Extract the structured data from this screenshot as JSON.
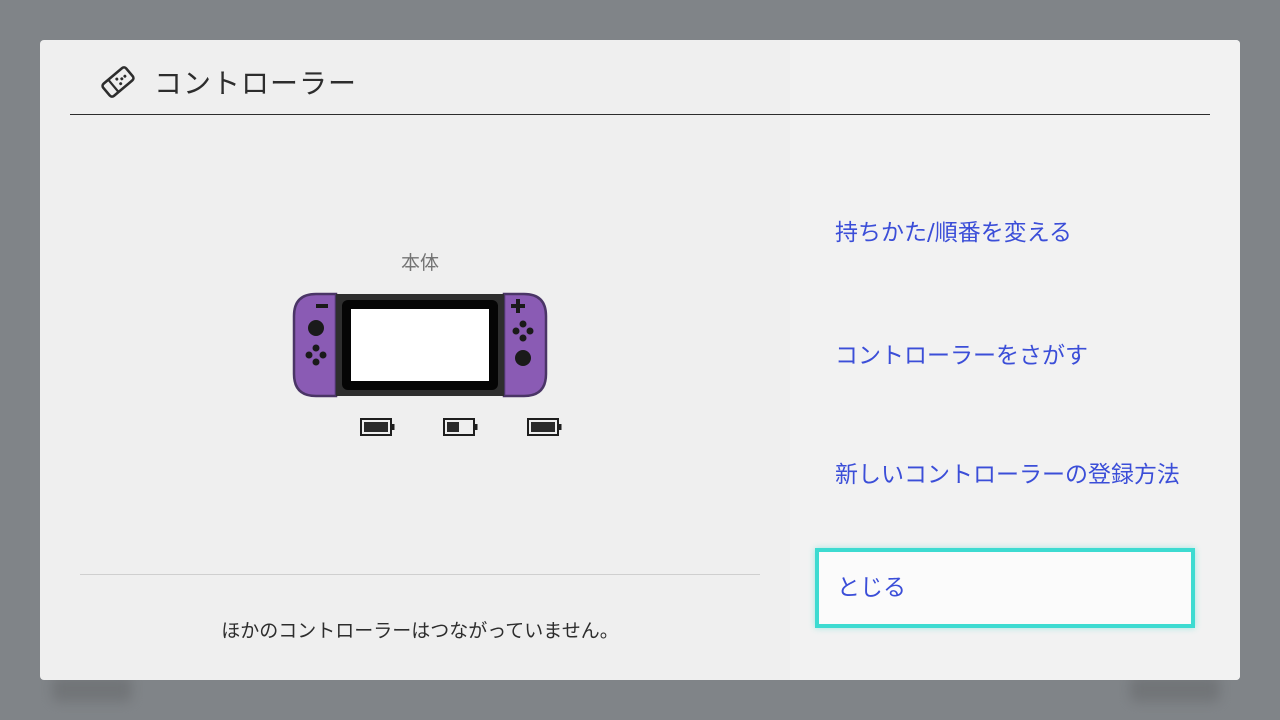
{
  "header": {
    "title": "コントローラー"
  },
  "console": {
    "label": "本体",
    "batteries": [
      {
        "name": "left-joycon",
        "level": 1.0
      },
      {
        "name": "console",
        "level": 0.5
      },
      {
        "name": "right-joycon",
        "level": 1.0
      }
    ],
    "joycon_color": "#8a5bb4"
  },
  "status": {
    "message": "ほかのコントローラーはつながっていません。"
  },
  "menu": {
    "items": [
      {
        "label": "持ちかた/順番を変える"
      },
      {
        "label": "コントローラーをさがす"
      },
      {
        "label": "新しいコントローラーの登録方法"
      },
      {
        "label": "とじる",
        "selected": true
      }
    ]
  },
  "colors": {
    "accent": "#3b4ed8",
    "selection_border": "#3ddbd1"
  }
}
